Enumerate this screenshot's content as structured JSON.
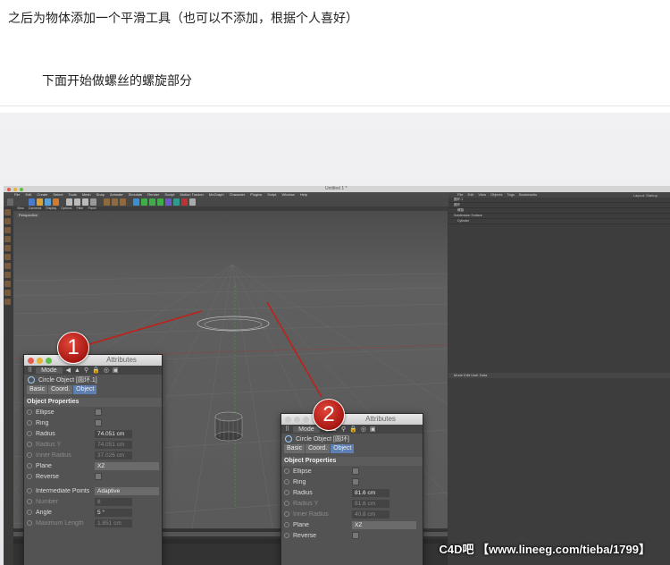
{
  "article": {
    "caption_1": "之后为物体添加一个平滑工具（也可以不添加，根据个人喜好）",
    "caption_2": "下面开始做螺丝的螺旋部分"
  },
  "app": {
    "window_title": "Untitled 1 *",
    "menu": [
      "File",
      "Edit",
      "Create",
      "Select",
      "Tools",
      "Mesh",
      "Snap",
      "Animate",
      "Simulate",
      "Render",
      "Sculpt",
      "Motion Tracker",
      "MoGraph",
      "Character",
      "Plugins",
      "Script",
      "Window",
      "Help"
    ],
    "layout_label": "Layout:",
    "layout_value": "Startup",
    "viewport_menu": [
      "View",
      "Cameras",
      "Display",
      "Options",
      "Filter",
      "Panel"
    ],
    "viewport_label": "Perspective",
    "object_manager": {
      "menu": [
        "File",
        "Edit",
        "View",
        "Objects",
        "Tags",
        "Bookmarks"
      ],
      "rows": [
        "圆环.1",
        "圆环",
        "螺旋",
        "Subdivision Surface",
        "Cylinder"
      ]
    },
    "attributes_mini_menu": [
      "Mode",
      "Edit",
      "User Data"
    ]
  },
  "panel_1": {
    "title": "Attributes",
    "mode_label": "Mode",
    "object_name": "Circle Object [圆环.1]",
    "tabs": [
      "Basic",
      "Coord.",
      "Object"
    ],
    "section": "Object Properties",
    "rows": {
      "ellipse": "Ellipse",
      "ring": "Ring",
      "radius": "Radius",
      "radius_value": "74.051 cm",
      "radius_y": "Radius Y",
      "radius_y_value": "74.051 cm",
      "inner_radius": "Inner Radius",
      "inner_radius_value": "37.026 cm",
      "plane": "Plane",
      "plane_value": "XZ",
      "reverse": "Reverse",
      "interp": "Intermediate Points",
      "interp_value": "Adaptive",
      "number": "Number",
      "number_value": "8",
      "angle": "Angle",
      "angle_value": "5 °",
      "max_length": "Maximum Length",
      "max_length_value": "1.851 cm"
    }
  },
  "panel_2": {
    "title": "Attributes",
    "mode_label": "Mode",
    "object_name": "Circle Object [圆环]",
    "tabs": [
      "Basic",
      "Coord.",
      "Object"
    ],
    "section": "Object Properties",
    "rows": {
      "ellipse": "Ellipse",
      "ring": "Ring",
      "radius": "Radius",
      "radius_value": "81.6 cm",
      "radius_y": "Radius Y",
      "radius_y_value": "81.6 cm",
      "inner_radius": "Inner Radius",
      "inner_radius_value": "40.8 cm",
      "plane": "Plane",
      "plane_value": "XZ",
      "reverse": "Reverse"
    }
  },
  "callouts": {
    "one": "1",
    "two": "2"
  },
  "watermark": "C4D吧 【www.lineeg.com/tieba/1799】",
  "colors": {
    "callout_red": "#c0201a",
    "active_tab": "#5d7fb1",
    "panel_bg": "#535353"
  }
}
